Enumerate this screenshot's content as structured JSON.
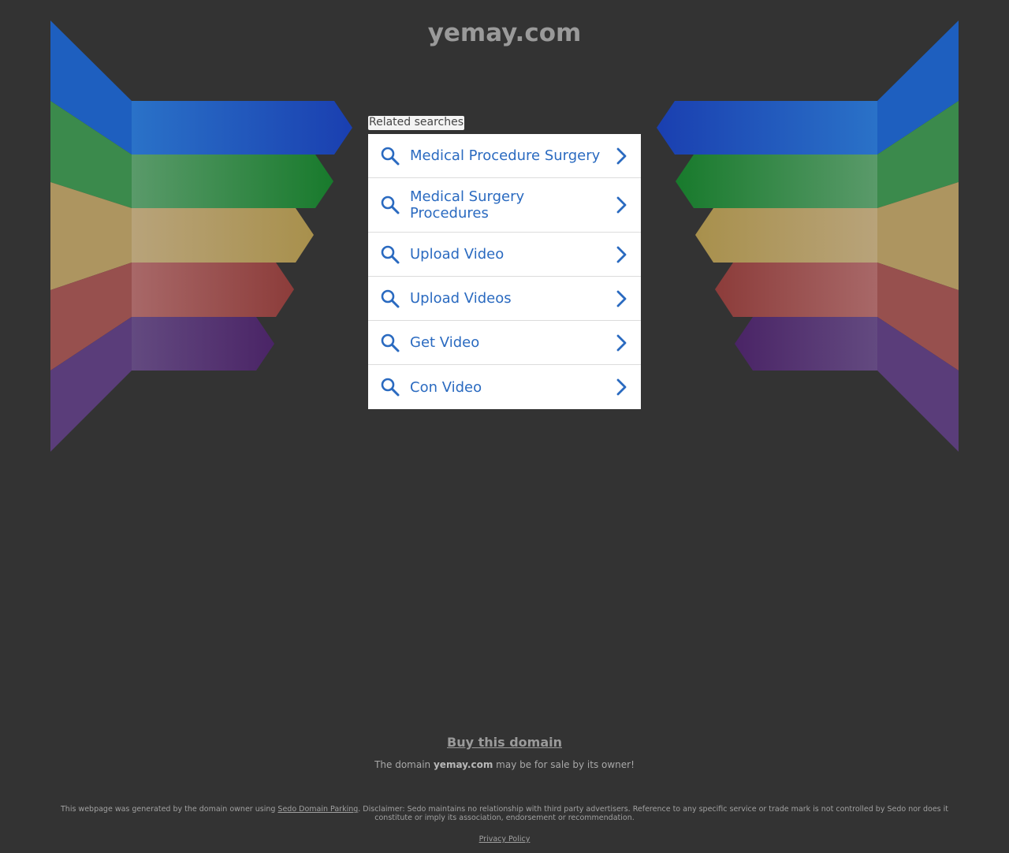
{
  "header": {
    "domain": "yemay.com"
  },
  "related": {
    "label": "Related searches",
    "items": [
      {
        "label": "Medical Procedure Surgery"
      },
      {
        "label": "Medical Surgery Procedures"
      },
      {
        "label": "Upload Video"
      },
      {
        "label": "Upload Videos"
      },
      {
        "label": "Get Video"
      },
      {
        "label": "Con Video"
      }
    ]
  },
  "sale": {
    "buy_link": "Buy this domain",
    "prefix": "The domain",
    "domain": "yemay.com",
    "suffix": "may be for sale by its owner!"
  },
  "footer": {
    "disclaimer_prefix": "This webpage was generated by the domain owner using",
    "sedo_link": "Sedo Domain Parking",
    "disclaimer_suffix": ". Disclaimer: Sedo maintains no relationship with third party advertisers. Reference to any specific service or trade mark is not controlled by Sedo nor does it constitute or imply its association, endorsement or recommendation.",
    "privacy_link": "Privacy Policy"
  },
  "colors": {
    "background": "#333333",
    "link_blue": "#2a6ac0",
    "stripe_blue": "#1f56b8",
    "stripe_green": "#2f8a3f",
    "stripe_tan": "#b0985a",
    "stripe_red": "#9a4a48",
    "stripe_purple": "#5a3a78"
  }
}
